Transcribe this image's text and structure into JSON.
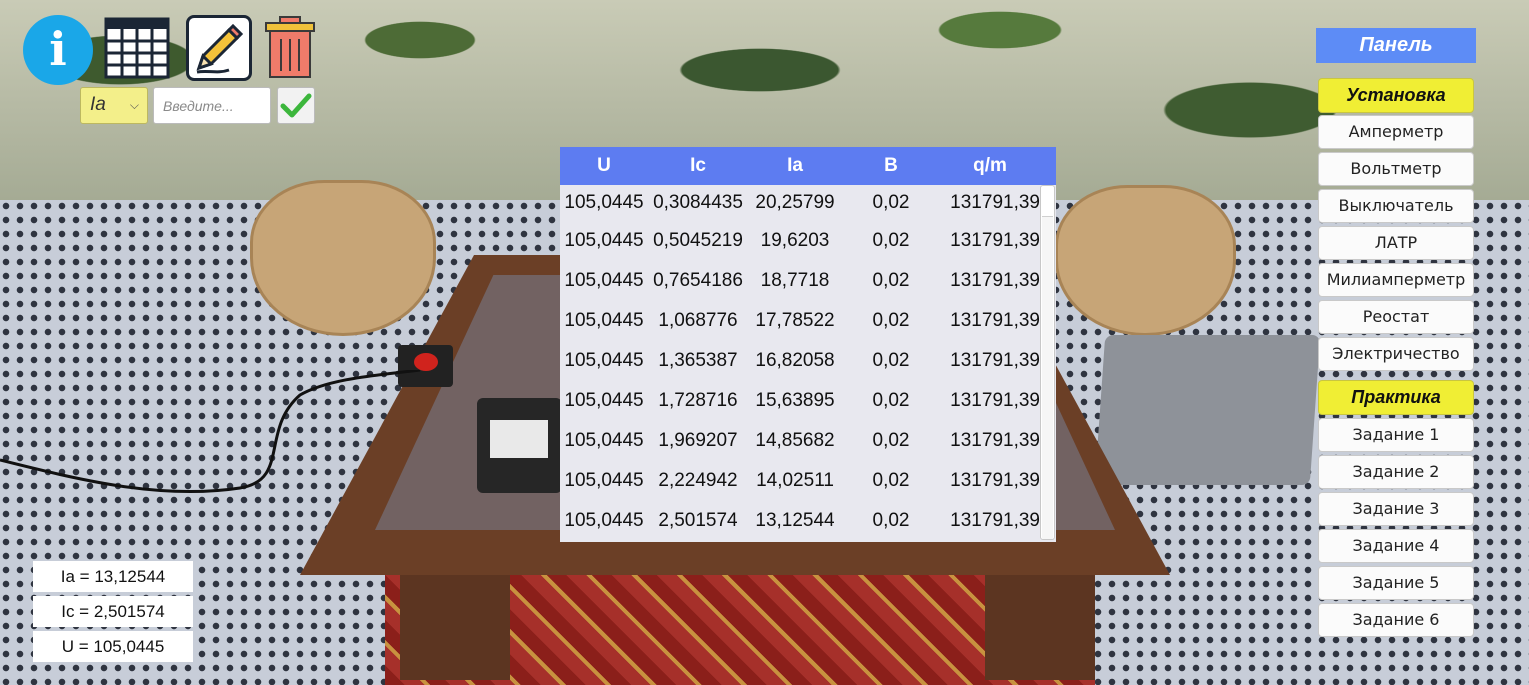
{
  "toolbar": {
    "info_icon": "info-icon",
    "info_glyph": "i",
    "table_icon": "table-icon",
    "edit_icon": "pencil-icon",
    "trash_icon": "trash-icon",
    "variable_select": {
      "selected": "Ia",
      "icon": "chevron-down-icon"
    },
    "value_input": {
      "placeholder": "Введите...",
      "value": ""
    },
    "confirm_icon": "checkmark-icon"
  },
  "data_table": {
    "columns": [
      "U",
      "Ic",
      "Ia",
      "B",
      "q/m"
    ],
    "rows": [
      [
        "105,0445",
        "0,3084435",
        "20,25799",
        "0,02",
        "131791,39"
      ],
      [
        "105,0445",
        "0,5045219",
        "19,6203",
        "0,02",
        "131791,39"
      ],
      [
        "105,0445",
        "0,7654186",
        "18,7718",
        "0,02",
        "131791,39"
      ],
      [
        "105,0445",
        "1,068776",
        "17,78522",
        "0,02",
        "131791,39"
      ],
      [
        "105,0445",
        "1,365387",
        "16,82058",
        "0,02",
        "131791,39"
      ],
      [
        "105,0445",
        "1,728716",
        "15,63895",
        "0,02",
        "131791,39"
      ],
      [
        "105,0445",
        "1,969207",
        "14,85682",
        "0,02",
        "131791,39"
      ],
      [
        "105,0445",
        "2,224942",
        "14,02511",
        "0,02",
        "131791,39"
      ],
      [
        "105,0445",
        "2,501574",
        "13,12544",
        "0,02",
        "131791,39"
      ]
    ]
  },
  "readouts": {
    "ia": "Ia = 13,12544",
    "ic": "Ic = 2,501574",
    "u": "U = 105,0445"
  },
  "panel": {
    "title": "Панель",
    "setup_section": "Установка",
    "setup_items": [
      "Амперметр",
      "Вольтметр",
      "Выключатель",
      "ЛАТР",
      "Милиамперметр",
      "Реостат",
      "Электричество"
    ],
    "practice_section": "Практика",
    "practice_items": [
      "Задание 1",
      "Задание 2",
      "Задание 3",
      "Задание 4",
      "Задание 5",
      "Задание 6"
    ]
  },
  "colors": {
    "header_blue": "#5d7cf1",
    "panel_title_blue": "#5d8cf6",
    "section_yellow": "#f0ee34",
    "select_yellow": "#f3ef8a",
    "info_blue": "#1aa7e8",
    "trash_red": "#f07b6a",
    "check_green": "#3cb63c"
  }
}
